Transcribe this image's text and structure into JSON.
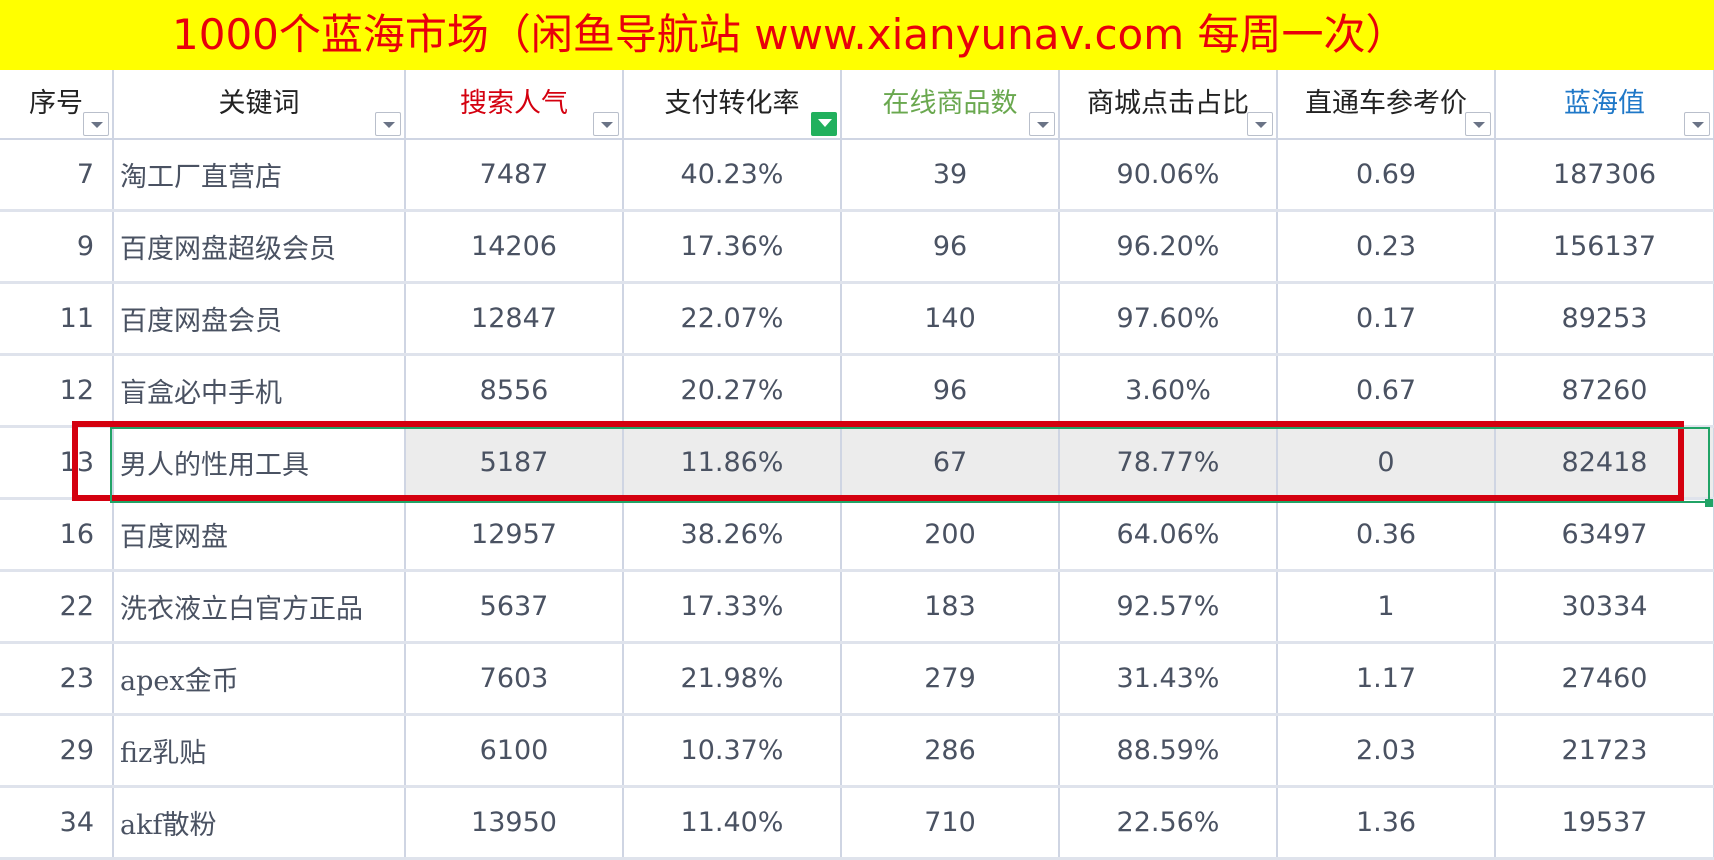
{
  "banner": {
    "title": "1000个蓝海市场（闲鱼导航站 www.xianyunav.com   每周一次）"
  },
  "columns": [
    {
      "label": "序号",
      "color": "#222222",
      "filter_active": false
    },
    {
      "label": "关键词",
      "color": "#222222",
      "filter_active": false
    },
    {
      "label": "搜索人气",
      "color": "#d4000f",
      "filter_active": false
    },
    {
      "label": "支付转化率",
      "color": "#222222",
      "filter_active": true
    },
    {
      "label": "在线商品数",
      "color": "#6aa84f",
      "filter_active": false
    },
    {
      "label": "商城点击占比",
      "color": "#222222",
      "filter_active": false
    },
    {
      "label": "直通车参考价",
      "color": "#222222",
      "filter_active": false
    },
    {
      "label": "蓝海值",
      "color": "#1f78c8",
      "filter_active": false
    }
  ],
  "rows": [
    [
      "7",
      "淘工厂直营店",
      "7487",
      "40.23%",
      "39",
      "90.06%",
      "0.69",
      "187306"
    ],
    [
      "9",
      "百度网盘超级会员",
      "14206",
      "17.36%",
      "96",
      "96.20%",
      "0.23",
      "156137"
    ],
    [
      "11",
      "百度网盘会员",
      "12847",
      "22.07%",
      "140",
      "97.60%",
      "0.17",
      "89253"
    ],
    [
      "12",
      "盲盒必中手机",
      "8556",
      "20.27%",
      "96",
      "3.60%",
      "0.67",
      "87260"
    ],
    [
      "13",
      "男人的性用工具",
      "5187",
      "11.86%",
      "67",
      "78.77%",
      "0",
      "82418"
    ],
    [
      "16",
      "百度网盘",
      "12957",
      "38.26%",
      "200",
      "64.06%",
      "0.36",
      "63497"
    ],
    [
      "22",
      "洗衣液立白官方正品",
      "5637",
      "17.33%",
      "183",
      "92.57%",
      "1",
      "30334"
    ],
    [
      "23",
      "apex金币",
      "7603",
      "21.98%",
      "279",
      "31.43%",
      "1.17",
      "27460"
    ],
    [
      "29",
      "fiz乳贴",
      "6100",
      "10.37%",
      "286",
      "88.59%",
      "2.03",
      "21723"
    ],
    [
      "34",
      "akf散粉",
      "13950",
      "11.40%",
      "710",
      "22.56%",
      "1.36",
      "19537"
    ]
  ],
  "selected_row_index": 4
}
